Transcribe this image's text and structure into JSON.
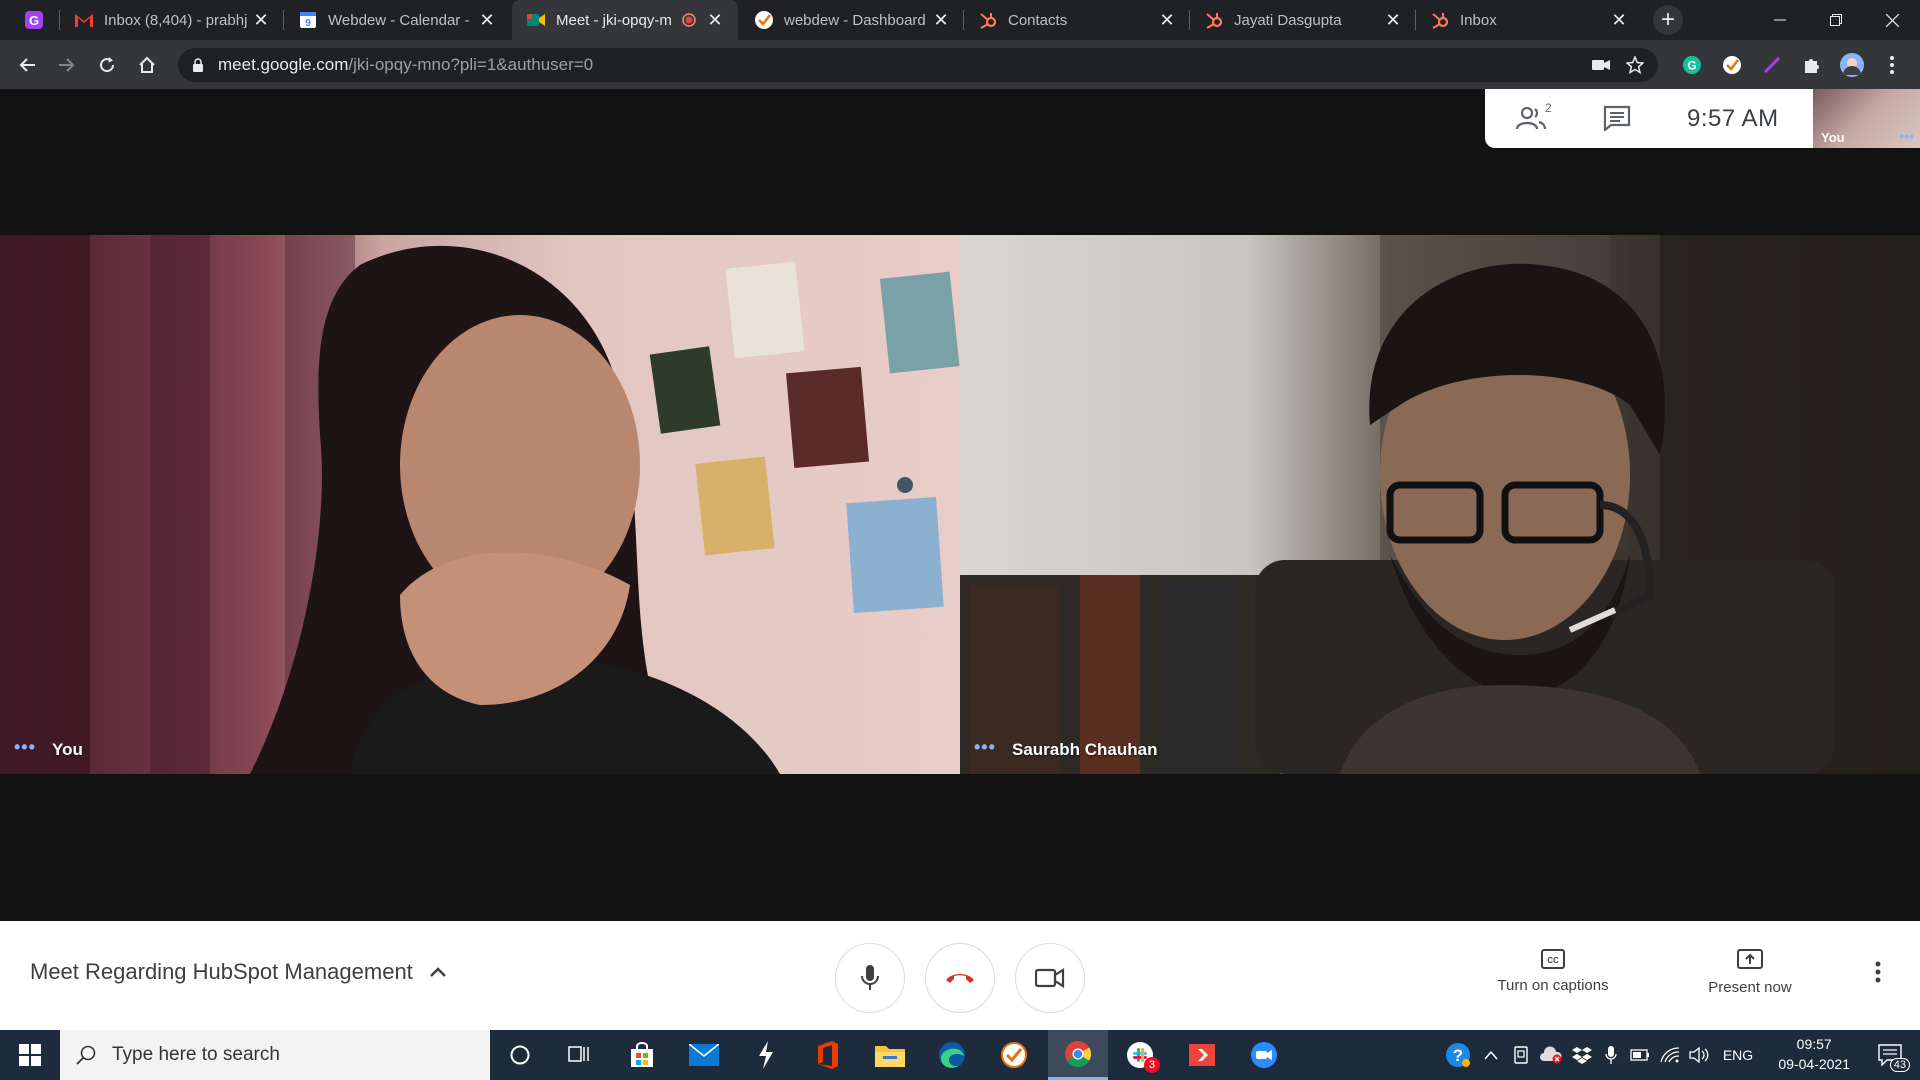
{
  "browser": {
    "tabs": [
      {
        "title": "",
        "favicon": "app-launcher-icon"
      },
      {
        "title": "Inbox (8,404) - prabhj",
        "favicon": "gmail-icon"
      },
      {
        "title": "Webdew - Calendar -",
        "favicon": "calendar-icon"
      },
      {
        "title": "Meet - jki-opqy-m",
        "favicon": "meet-icon",
        "active": true
      },
      {
        "title": "webdew - Dashboard",
        "favicon": "check-icon"
      },
      {
        "title": "Contacts",
        "favicon": "hubspot-icon"
      },
      {
        "title": "Jayati Dasgupta",
        "favicon": "hubspot-icon"
      },
      {
        "title": "Inbox",
        "favicon": "hubspot-icon"
      }
    ],
    "close_glyph": "✕",
    "new_tab_glyph": "+",
    "url_host": "meet.google.com",
    "url_path": "/jki-opqy-mno?pli=1&authuser=0"
  },
  "meet": {
    "participant_count": "2",
    "clock": "9:57  AM",
    "self_thumb_label": "You",
    "tiles": [
      {
        "name": "You"
      },
      {
        "name": "Saurabh Chauhan"
      }
    ],
    "meeting_title": "Meet Regarding HubSpot Management",
    "captions_label": "Turn on captions",
    "present_label": "Present now"
  },
  "taskbar": {
    "search_placeholder": "Type here to search",
    "language": "ENG",
    "time": "09:57",
    "date": "09-04-2021",
    "notification_count": "43",
    "slack_badge": "3"
  },
  "colors": {
    "end_call": "#d93025",
    "accent_blue": "#8ab4f8",
    "taskbar": "#1d2b3c"
  }
}
